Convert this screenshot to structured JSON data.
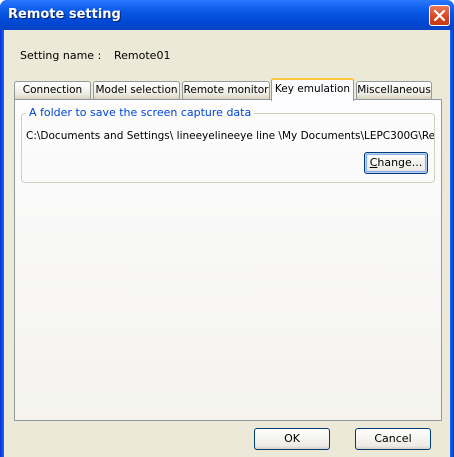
{
  "window": {
    "title": "Remote setting",
    "close_icon": "close-icon"
  },
  "setting": {
    "label": "Setting name :",
    "value": "Remote01"
  },
  "tabs": [
    {
      "label": "Connection",
      "active": false
    },
    {
      "label": "Model selection",
      "active": false
    },
    {
      "label": "Remote monitor",
      "active": false
    },
    {
      "label": "Key emulation",
      "active": true
    },
    {
      "label": "Miscellaneous",
      "active": false
    }
  ],
  "group": {
    "caption": "A folder to save the screen capture data",
    "path": "C:\\Documents and Settings\\ lineeyelineeye line \\My Documents\\LEPC300G\\Re",
    "change_button": {
      "mnemonic": "C",
      "rest": "hange..."
    }
  },
  "footer": {
    "ok_label": "OK",
    "cancel_label": "Cancel"
  },
  "colors": {
    "title_bar": "#0054e3",
    "dialog_bg": "#ece9d8",
    "group_caption": "#0046d5",
    "active_tab_accent": "#ffc83c"
  }
}
